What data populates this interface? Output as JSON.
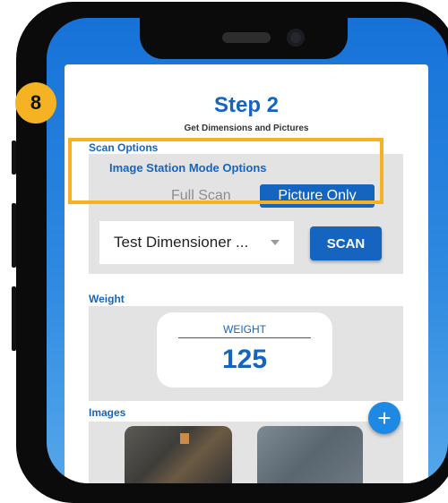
{
  "callout_number": "8",
  "step": {
    "title": "Step 2",
    "subtitle": "Get Dimensions and Pictures"
  },
  "scan_options": {
    "section_label": "Scan Options",
    "mode_title": "Image Station Mode Options",
    "modes": [
      "Full Scan",
      "Picture Only"
    ],
    "selected_mode": "Picture Only",
    "dimensioner_value": "Test Dimensioner ...",
    "scan_button": "SCAN"
  },
  "weight": {
    "section_label": "Weight",
    "label": "WEIGHT",
    "value": "125"
  },
  "images": {
    "section_label": "Images",
    "add_button": "+"
  },
  "colors": {
    "accent": "#1565c0",
    "highlight": "#f5b324",
    "panel": "#e3e3e3",
    "fab": "#1e88e5"
  }
}
